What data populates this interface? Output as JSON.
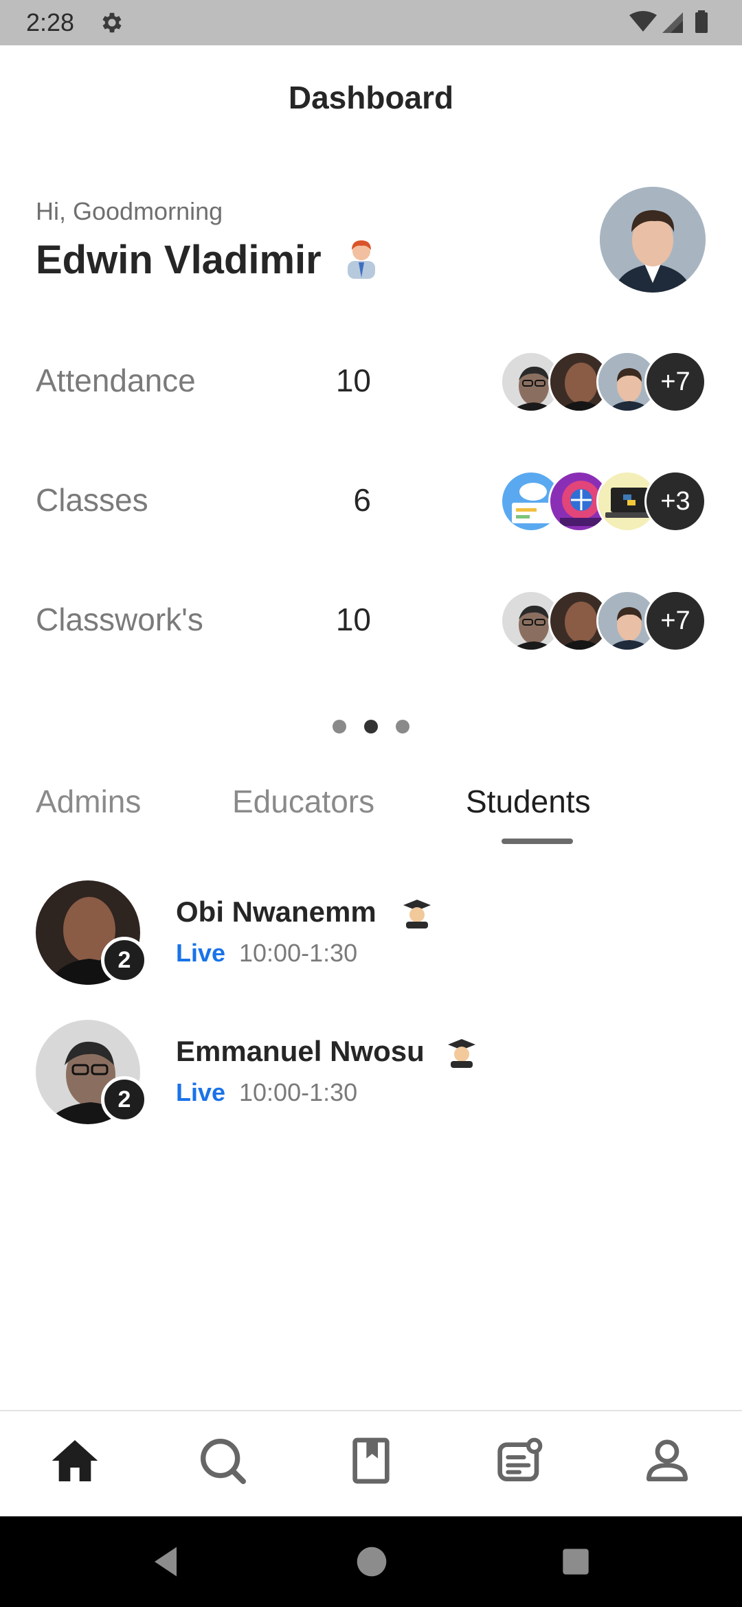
{
  "status_bar": {
    "time": "2:28"
  },
  "header": {
    "title": "Dashboard"
  },
  "greeting": {
    "subtitle": "Hi, Goodmorning",
    "name": "Edwin Vladimir"
  },
  "stats": [
    {
      "label": "Attendance",
      "value": "10",
      "more": "+7"
    },
    {
      "label": "Classes",
      "value": "6",
      "more": "+3"
    },
    {
      "label": "Classwork's",
      "value": "10",
      "more": "+7"
    }
  ],
  "tabs": [
    {
      "label": "Admins"
    },
    {
      "label": "Educators"
    },
    {
      "label": "Students"
    }
  ],
  "active_tab": "Students",
  "students": [
    {
      "name": "Obi Nwanemm",
      "badge": "2",
      "status": "Live",
      "time": "10:00-1:30"
    },
    {
      "name": "Emmanuel Nwosu",
      "badge": "2",
      "status": "Live",
      "time": "10:00-1:30"
    }
  ],
  "bottom_nav": [
    {
      "icon": "home-icon"
    },
    {
      "icon": "search-icon"
    },
    {
      "icon": "bookmark-icon"
    },
    {
      "icon": "notes-icon"
    },
    {
      "icon": "profile-icon"
    }
  ],
  "colors": {
    "live": "#1a73e8",
    "accent": "#1e1e1e"
  }
}
